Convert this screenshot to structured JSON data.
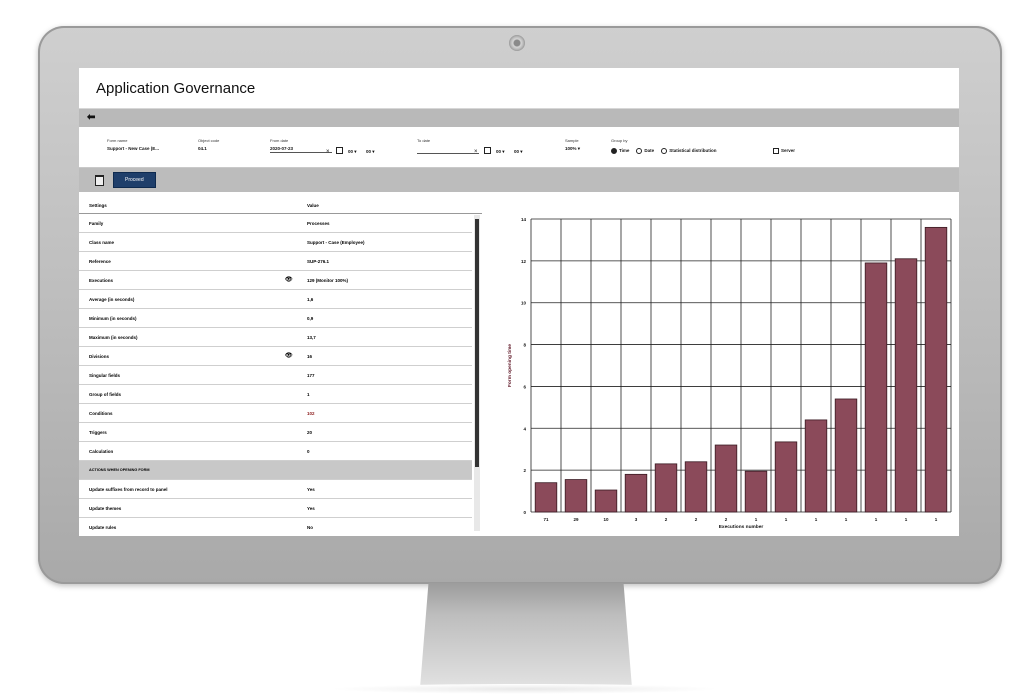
{
  "app": {
    "title": "Application Governance"
  },
  "nav": {
    "back_icon": "arrow-left-icon"
  },
  "filters": {
    "form_name": {
      "label": "Form name",
      "value": "Support - New Case (E..."
    },
    "object_code": {
      "label": "Object code",
      "value": "04.1"
    },
    "from_date": {
      "label": "From date",
      "value": "2020-07-23",
      "clear": "×",
      "hour": "00 ▾",
      "minute": "00 ▾"
    },
    "to_date": {
      "label": "To date",
      "value": "",
      "clear": "×",
      "hour": "00 ▾",
      "minute": "00 ▾"
    },
    "sample": {
      "label": "Sample",
      "value": "100% ▾"
    },
    "group_by": {
      "label": "Group by",
      "options": [
        "Time",
        "Date",
        "Statistical distribution"
      ],
      "selected": "Time"
    },
    "server": {
      "label": "Server"
    }
  },
  "actions": {
    "proceed": "Proceed",
    "delete_icon": "trash-icon"
  },
  "table": {
    "header": {
      "settings": "Settings",
      "value": "Value"
    },
    "rows": [
      {
        "key": "Family",
        "value": "Processes"
      },
      {
        "key": "Class name",
        "value": "Support - Case (Employee)"
      },
      {
        "key": "Reference",
        "value": "SUP-276.1"
      },
      {
        "key": "Executions",
        "value": "129 (Monitor 100%)",
        "eye": true
      },
      {
        "key": "Average (in seconds)",
        "value": "1,6"
      },
      {
        "key": "Minimum (in seconds)",
        "value": "0,9"
      },
      {
        "key": "Maximum (in seconds)",
        "value": "13,7"
      },
      {
        "key": "Divisions",
        "value": "16",
        "eye": true
      },
      {
        "key": "Singular fields",
        "value": "177"
      },
      {
        "key": "Group of fields",
        "value": "1"
      },
      {
        "key": "Conditions",
        "value": "102",
        "highlight": true
      },
      {
        "key": "Triggers",
        "value": "20"
      },
      {
        "key": "Calculation",
        "value": "0"
      },
      {
        "key": "ACTIONS WHEN OPENING FORM",
        "value": "",
        "section": true
      },
      {
        "key": "Update suffixes from record to panel",
        "value": "Yes"
      },
      {
        "key": "Update themes",
        "value": "Yes"
      },
      {
        "key": "Update rules",
        "value": "No"
      }
    ]
  },
  "chart_data": {
    "type": "bar",
    "categories": [
      "71",
      "29",
      "10",
      "3",
      "2",
      "2",
      "2",
      "1",
      "1",
      "1",
      "1",
      "1",
      "1",
      "1"
    ],
    "values": [
      1.4,
      1.55,
      1.05,
      1.8,
      2.3,
      2.4,
      3.2,
      1.95,
      3.35,
      4.4,
      5.4,
      11.9,
      12.1,
      13.6
    ],
    "xlabel": "Executions number",
    "ylabel": "Form opening time",
    "ylim": [
      0,
      14
    ],
    "yticks": [
      0,
      2,
      4,
      6,
      8,
      10,
      12,
      14
    ],
    "bar_color": "#8b4a5a",
    "grid": true
  }
}
